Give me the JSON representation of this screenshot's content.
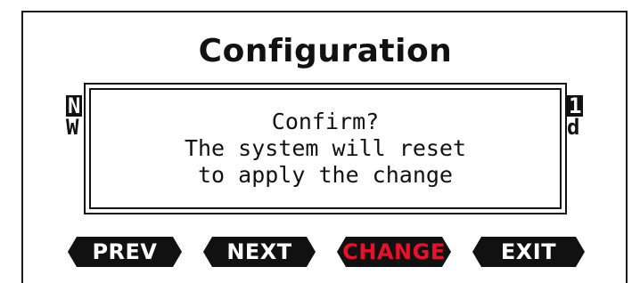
{
  "screen": {
    "title": "Configuration"
  },
  "background_rows": {
    "row1_left": "N",
    "row2_left": "W",
    "row1_right": "1",
    "row2_right": "d"
  },
  "dialog": {
    "line1": "Confirm?",
    "line2": "The system will reset",
    "line3": "to apply the change"
  },
  "softkeys": {
    "prev": "PREV",
    "next": "NEXT",
    "change": "CHANGE",
    "exit": "EXIT"
  },
  "colors": {
    "screen_bg": "#ffffff",
    "ink": "#111111",
    "highlight_text": "#e8102a"
  }
}
